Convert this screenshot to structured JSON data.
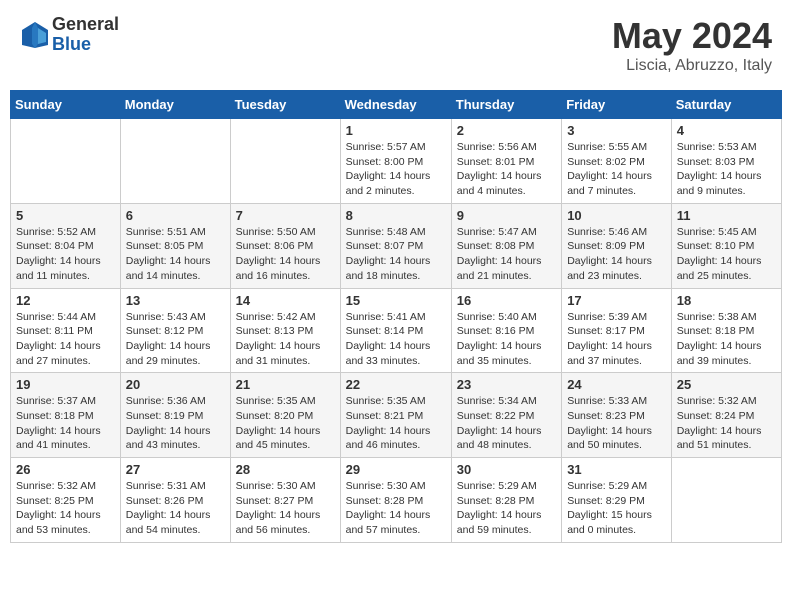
{
  "header": {
    "logo_general": "General",
    "logo_blue": "Blue",
    "month_title": "May 2024",
    "location": "Liscia, Abruzzo, Italy"
  },
  "days_of_week": [
    "Sunday",
    "Monday",
    "Tuesday",
    "Wednesday",
    "Thursday",
    "Friday",
    "Saturday"
  ],
  "weeks": [
    [
      {
        "day": "",
        "info": ""
      },
      {
        "day": "",
        "info": ""
      },
      {
        "day": "",
        "info": ""
      },
      {
        "day": "1",
        "info": "Sunrise: 5:57 AM\nSunset: 8:00 PM\nDaylight: 14 hours\nand 2 minutes."
      },
      {
        "day": "2",
        "info": "Sunrise: 5:56 AM\nSunset: 8:01 PM\nDaylight: 14 hours\nand 4 minutes."
      },
      {
        "day": "3",
        "info": "Sunrise: 5:55 AM\nSunset: 8:02 PM\nDaylight: 14 hours\nand 7 minutes."
      },
      {
        "day": "4",
        "info": "Sunrise: 5:53 AM\nSunset: 8:03 PM\nDaylight: 14 hours\nand 9 minutes."
      }
    ],
    [
      {
        "day": "5",
        "info": "Sunrise: 5:52 AM\nSunset: 8:04 PM\nDaylight: 14 hours\nand 11 minutes."
      },
      {
        "day": "6",
        "info": "Sunrise: 5:51 AM\nSunset: 8:05 PM\nDaylight: 14 hours\nand 14 minutes."
      },
      {
        "day": "7",
        "info": "Sunrise: 5:50 AM\nSunset: 8:06 PM\nDaylight: 14 hours\nand 16 minutes."
      },
      {
        "day": "8",
        "info": "Sunrise: 5:48 AM\nSunset: 8:07 PM\nDaylight: 14 hours\nand 18 minutes."
      },
      {
        "day": "9",
        "info": "Sunrise: 5:47 AM\nSunset: 8:08 PM\nDaylight: 14 hours\nand 21 minutes."
      },
      {
        "day": "10",
        "info": "Sunrise: 5:46 AM\nSunset: 8:09 PM\nDaylight: 14 hours\nand 23 minutes."
      },
      {
        "day": "11",
        "info": "Sunrise: 5:45 AM\nSunset: 8:10 PM\nDaylight: 14 hours\nand 25 minutes."
      }
    ],
    [
      {
        "day": "12",
        "info": "Sunrise: 5:44 AM\nSunset: 8:11 PM\nDaylight: 14 hours\nand 27 minutes."
      },
      {
        "day": "13",
        "info": "Sunrise: 5:43 AM\nSunset: 8:12 PM\nDaylight: 14 hours\nand 29 minutes."
      },
      {
        "day": "14",
        "info": "Sunrise: 5:42 AM\nSunset: 8:13 PM\nDaylight: 14 hours\nand 31 minutes."
      },
      {
        "day": "15",
        "info": "Sunrise: 5:41 AM\nSunset: 8:14 PM\nDaylight: 14 hours\nand 33 minutes."
      },
      {
        "day": "16",
        "info": "Sunrise: 5:40 AM\nSunset: 8:16 PM\nDaylight: 14 hours\nand 35 minutes."
      },
      {
        "day": "17",
        "info": "Sunrise: 5:39 AM\nSunset: 8:17 PM\nDaylight: 14 hours\nand 37 minutes."
      },
      {
        "day": "18",
        "info": "Sunrise: 5:38 AM\nSunset: 8:18 PM\nDaylight: 14 hours\nand 39 minutes."
      }
    ],
    [
      {
        "day": "19",
        "info": "Sunrise: 5:37 AM\nSunset: 8:18 PM\nDaylight: 14 hours\nand 41 minutes."
      },
      {
        "day": "20",
        "info": "Sunrise: 5:36 AM\nSunset: 8:19 PM\nDaylight: 14 hours\nand 43 minutes."
      },
      {
        "day": "21",
        "info": "Sunrise: 5:35 AM\nSunset: 8:20 PM\nDaylight: 14 hours\nand 45 minutes."
      },
      {
        "day": "22",
        "info": "Sunrise: 5:35 AM\nSunset: 8:21 PM\nDaylight: 14 hours\nand 46 minutes."
      },
      {
        "day": "23",
        "info": "Sunrise: 5:34 AM\nSunset: 8:22 PM\nDaylight: 14 hours\nand 48 minutes."
      },
      {
        "day": "24",
        "info": "Sunrise: 5:33 AM\nSunset: 8:23 PM\nDaylight: 14 hours\nand 50 minutes."
      },
      {
        "day": "25",
        "info": "Sunrise: 5:32 AM\nSunset: 8:24 PM\nDaylight: 14 hours\nand 51 minutes."
      }
    ],
    [
      {
        "day": "26",
        "info": "Sunrise: 5:32 AM\nSunset: 8:25 PM\nDaylight: 14 hours\nand 53 minutes."
      },
      {
        "day": "27",
        "info": "Sunrise: 5:31 AM\nSunset: 8:26 PM\nDaylight: 14 hours\nand 54 minutes."
      },
      {
        "day": "28",
        "info": "Sunrise: 5:30 AM\nSunset: 8:27 PM\nDaylight: 14 hours\nand 56 minutes."
      },
      {
        "day": "29",
        "info": "Sunrise: 5:30 AM\nSunset: 8:28 PM\nDaylight: 14 hours\nand 57 minutes."
      },
      {
        "day": "30",
        "info": "Sunrise: 5:29 AM\nSunset: 8:28 PM\nDaylight: 14 hours\nand 59 minutes."
      },
      {
        "day": "31",
        "info": "Sunrise: 5:29 AM\nSunset: 8:29 PM\nDaylight: 15 hours\nand 0 minutes."
      },
      {
        "day": "",
        "info": ""
      }
    ]
  ]
}
